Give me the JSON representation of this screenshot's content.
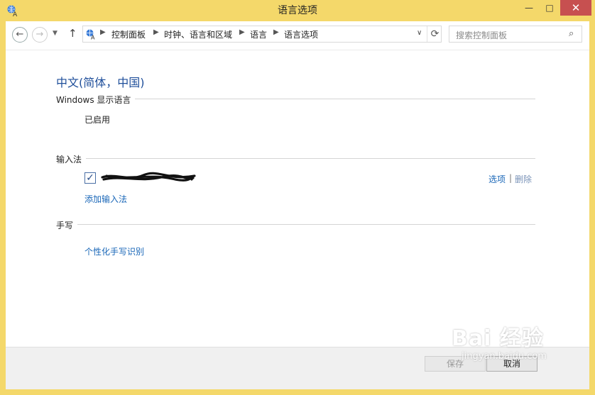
{
  "window": {
    "title": "语言选项",
    "minimize": "—",
    "maximize": "□",
    "close": "✕"
  },
  "nav": {
    "back": "←",
    "forward": "→",
    "recent": "▼",
    "up": "↑",
    "breadcrumbs": [
      "控制面板",
      "时钟、语言和区域",
      "语言",
      "语言选项"
    ],
    "separator": "▶",
    "dropdown": "∨",
    "refresh": "⟳",
    "search_placeholder": "搜索控制面板",
    "search_icon": "⌕"
  },
  "main": {
    "language_title": "中文(简体，中国)",
    "display_language": {
      "label": "Windows 显示语言",
      "status": "已启用"
    },
    "input_method": {
      "label": "输入法",
      "check": "✓",
      "options_link": "选项",
      "divider": "|",
      "remove_link": "删除",
      "add_link": "添加输入法"
    },
    "handwriting": {
      "label": "手写",
      "personalize_link": "个性化手写识别"
    }
  },
  "footer": {
    "save_label": "保存",
    "cancel_label": "取消"
  },
  "watermark": {
    "brand": "Bai 经验",
    "url": "jingyan.baidu.com"
  },
  "colors": {
    "window_frame": "#f4d86a",
    "title_accent": "#1e4e9a",
    "link": "#1a67b8",
    "close_button": "#c75050"
  }
}
